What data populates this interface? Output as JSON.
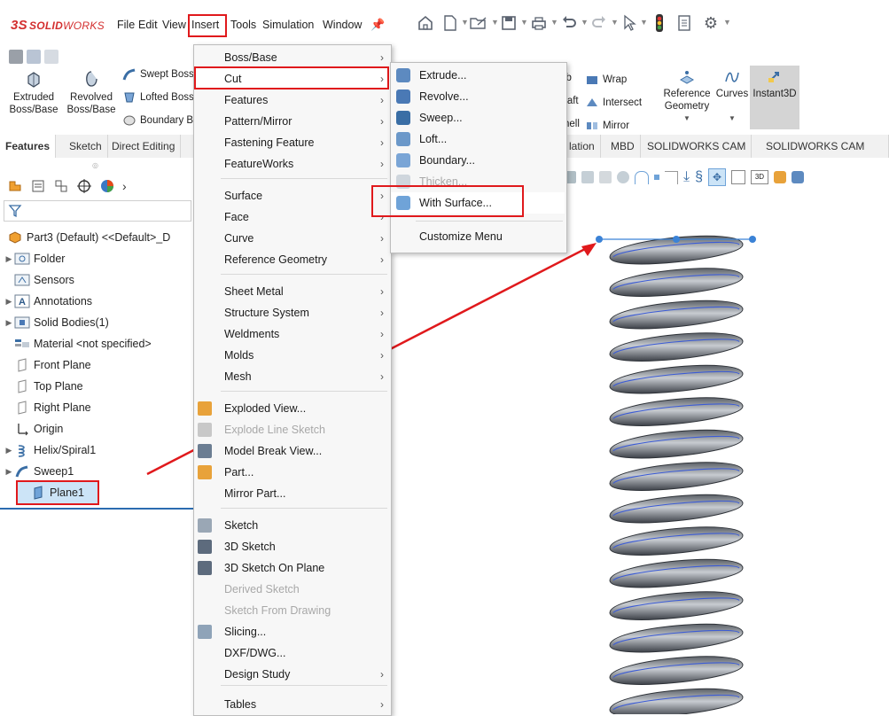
{
  "app": {
    "logo_prefix": "3S",
    "logo_brand": "SOLID",
    "logo_suffix": "WORKS"
  },
  "menubar": [
    "File",
    "Edit",
    "View",
    "Insert",
    "Tools",
    "Simulation",
    "Window"
  ],
  "command_manager": {
    "extruded": [
      "Extruded",
      "Boss/Base"
    ],
    "revolved": [
      "Revolved",
      "Boss/Base"
    ],
    "swept_boss": "Swept Boss",
    "lofted_boss": "Lofted Boss",
    "boundary": "Boundary B",
    "rib": "ib",
    "wrap": "Wrap",
    "draft": "raft",
    "intersect": "Intersect",
    "shell": "hell",
    "mirror": "Mirror",
    "reference_geometry": [
      "Reference",
      "Geometry"
    ],
    "curves": "Curves",
    "instant3d": "Instant3D"
  },
  "tabs": [
    "Features",
    "Sketch",
    "Direct Editing",
    "lation",
    "MBD",
    "SOLIDWORKS CAM",
    "SOLIDWORKS CAM TBM"
  ],
  "feature_tree": {
    "root": "Part3 (Default) <<Default>_D",
    "items": [
      {
        "label": "Folder",
        "expandable": true
      },
      {
        "label": "Sensors",
        "expandable": false
      },
      {
        "label": "Annotations",
        "expandable": true
      },
      {
        "label": "Solid Bodies(1)",
        "expandable": true
      },
      {
        "label": "Material <not specified>",
        "expandable": false
      },
      {
        "label": "Front Plane",
        "expandable": false
      },
      {
        "label": "Top Plane",
        "expandable": false
      },
      {
        "label": "Right Plane",
        "expandable": false
      },
      {
        "label": "Origin",
        "expandable": false
      },
      {
        "label": "Helix/Spiral1",
        "expandable": true
      },
      {
        "label": "Sweep1",
        "expandable": true
      },
      {
        "label": "Plane1",
        "expandable": false,
        "selected": true
      }
    ]
  },
  "insert_menu": [
    {
      "label": "Boss/Base",
      "sub": true
    },
    {
      "label": "Cut",
      "sub": true,
      "highlight": true
    },
    {
      "label": "Features",
      "sub": true
    },
    {
      "label": "Pattern/Mirror",
      "sub": true
    },
    {
      "label": "Fastening Feature",
      "sub": true
    },
    {
      "label": "FeatureWorks",
      "sub": true
    },
    {
      "label": "Surface",
      "sub": true
    },
    {
      "label": "Face",
      "sub": true
    },
    {
      "label": "Curve",
      "sub": true
    },
    {
      "label": "Reference Geometry",
      "sub": true
    },
    {
      "label": "Sheet Metal",
      "sub": true
    },
    {
      "label": "Structure System",
      "sub": true
    },
    {
      "label": "Weldments",
      "sub": true
    },
    {
      "label": "Molds",
      "sub": true
    },
    {
      "label": "Mesh",
      "sub": true
    },
    {
      "label": "Exploded View...",
      "sub": false
    },
    {
      "label": "Explode Line Sketch",
      "sub": false,
      "disabled": true
    },
    {
      "label": "Model Break View...",
      "sub": false
    },
    {
      "label": "Part...",
      "sub": false
    },
    {
      "label": "Mirror Part...",
      "sub": false
    },
    {
      "label": "Sketch",
      "sub": false
    },
    {
      "label": "3D Sketch",
      "sub": false
    },
    {
      "label": "3D Sketch On Plane",
      "sub": false
    },
    {
      "label": "Derived Sketch",
      "sub": false,
      "disabled": true
    },
    {
      "label": "Sketch From Drawing",
      "sub": false,
      "disabled": true
    },
    {
      "label": "Slicing...",
      "sub": false
    },
    {
      "label": "DXF/DWG...",
      "sub": false
    },
    {
      "label": "Design Study",
      "sub": true
    },
    {
      "label": "Tables",
      "sub": true
    }
  ],
  "cut_submenu": [
    {
      "label": "Extrude..."
    },
    {
      "label": "Revolve..."
    },
    {
      "label": "Sweep..."
    },
    {
      "label": "Loft..."
    },
    {
      "label": "Boundary..."
    },
    {
      "label": "Thicken...",
      "disabled": true
    },
    {
      "label": "With Surface...",
      "highlight": true
    },
    {
      "label": "Customize Menu"
    }
  ],
  "colors": {
    "accent_red": "#e0191c",
    "selection_blue": "#cce4f7",
    "menu_bg": "#f7f7f7"
  }
}
